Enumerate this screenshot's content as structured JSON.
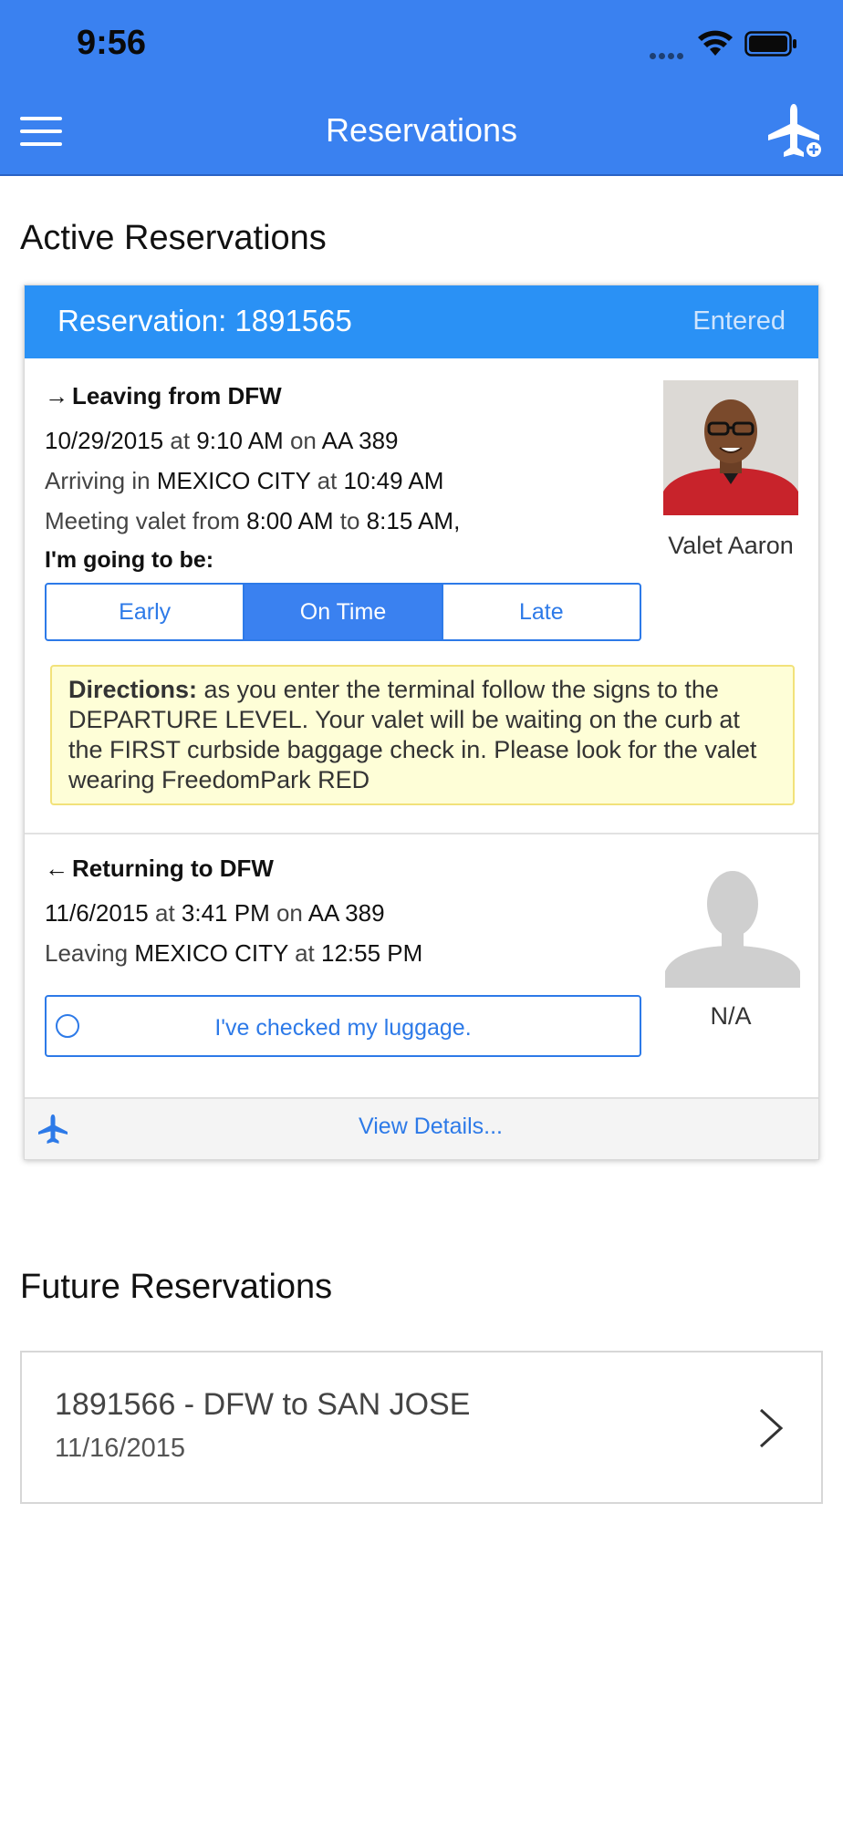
{
  "status_bar": {
    "time": "9:56"
  },
  "nav": {
    "title": "Reservations"
  },
  "sections": {
    "active": "Active Reservations",
    "future": "Future Reservations"
  },
  "reservation": {
    "number": "Reservation: 1891565",
    "status": "Entered",
    "outbound": {
      "title": "Leaving from DFW",
      "date": "10/29/2015",
      "time": "9:10 AM",
      "flight": "AA 389",
      "arriving_city": "MEXICO CITY",
      "arriving_time": "10:49 AM",
      "meet_from": "8:00 AM",
      "meet_to": "8:15 AM,",
      "prompt": "I'm going to be:",
      "options": [
        "Early",
        "On Time",
        "Late"
      ],
      "selected": "On Time",
      "valet_name": "Valet Aaron",
      "directions_label": "Directions:",
      "directions_text": "as you enter the terminal follow the signs to the DEPARTURE LEVEL. Your valet will be waiting on the curb at the FIRST curbside baggage check in. Please look for the valet wearing FreedomPark RED"
    },
    "return": {
      "title": "Returning to DFW",
      "date": "11/6/2015",
      "time": "3:41 PM",
      "flight": "AA 389",
      "leaving_city": "MEXICO CITY",
      "leaving_time": "12:55 PM",
      "luggage_label": "I've checked my luggage.",
      "valet_name": "N/A"
    },
    "details_link": "View Details..."
  },
  "words": {
    "at": "at",
    "on": "on",
    "arriving_in": "Arriving in",
    "leaving": "Leaving",
    "meeting_from": "Meeting valet from",
    "to": "to"
  },
  "future": [
    {
      "title": "1891566 - DFW to SAN JOSE",
      "date": "11/16/2015"
    }
  ],
  "colors": {
    "header": "#3a81f0",
    "card_header": "#2a91f5",
    "accent": "#2d7ae8",
    "directions_bg": "#fefed7"
  },
  "icons": [
    "menu-icon",
    "airplane-add-icon",
    "wifi-icon",
    "battery-icon",
    "arrow-right-icon",
    "arrow-left-icon",
    "airplane-icon",
    "chevron-right-icon"
  ]
}
